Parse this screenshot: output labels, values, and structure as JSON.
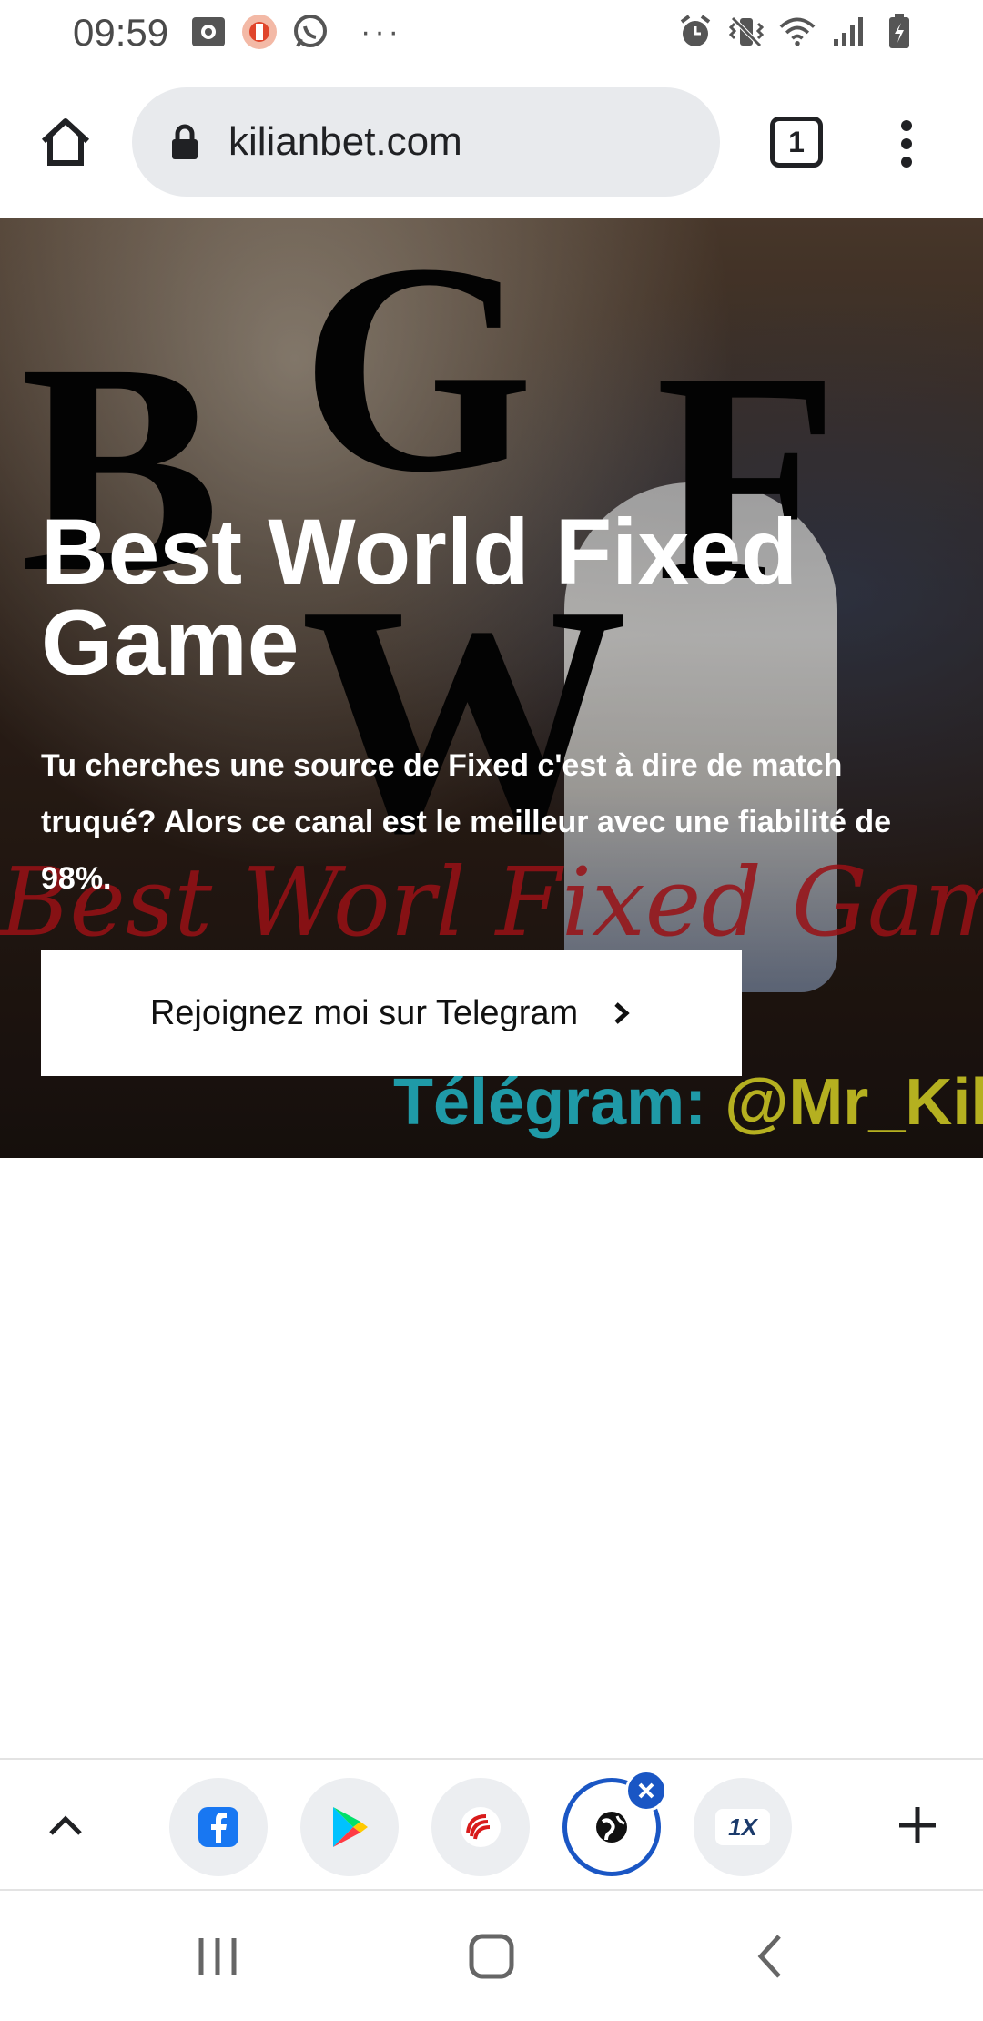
{
  "status_bar": {
    "time": "09:59",
    "notification_icons": [
      "gallery-icon",
      "app-notification-icon",
      "whatsapp-icon"
    ],
    "more_indicator": "···",
    "system_icons": [
      "alarm-icon",
      "vibrate-icon",
      "wifi-icon",
      "signal-icon",
      "battery-charging-icon"
    ]
  },
  "browser": {
    "url": "kilianbet.com",
    "tab_count": "1"
  },
  "hero": {
    "title": "Best World Fixed Game",
    "description": "Tu cherches une source de Fixed c'est à dire de match truqué? Alors ce canal est le meilleur avec une fiabilité de 98%.",
    "cta_label": "Rejoignez moi sur Telegram",
    "background_letters": {
      "b": "B",
      "g": "G",
      "f": "F",
      "w": "W"
    },
    "background_script": "Best Worl Fixed Game",
    "background_telegram_label": "Télégram:",
    "background_telegram_handle": "@Mr_Kilia"
  },
  "app_bar": {
    "apps": [
      {
        "name": "facebook-app",
        "icon": "facebook-icon"
      },
      {
        "name": "play-store-app",
        "icon": "play-store-icon"
      },
      {
        "name": "swirl-app",
        "icon": "swirl-icon"
      },
      {
        "name": "browser-app",
        "icon": "globe-icon",
        "active": true
      },
      {
        "name": "1xbet-app",
        "icon": "1x-icon",
        "label": "1X"
      }
    ]
  },
  "colors": {
    "accent": "#1a56c4",
    "url_bar": "#e8eaed",
    "script_red": "#c4161c",
    "telegram_cyan": "#28c6d6",
    "telegram_yellow": "#e8e22a"
  }
}
